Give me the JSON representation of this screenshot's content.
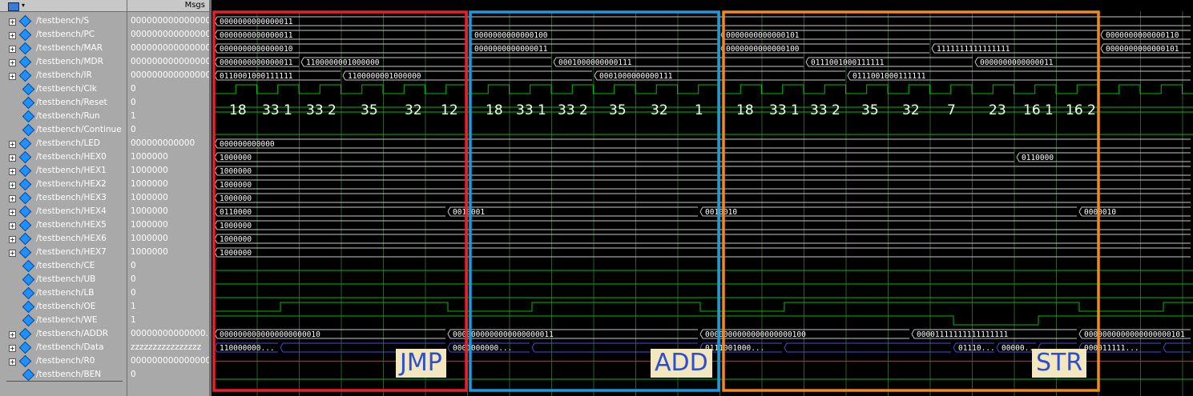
{
  "header": {
    "msgs_label": "Msgs"
  },
  "signals": [
    {
      "name": "/testbench/S",
      "value": "0000000000000000",
      "expandable": true
    },
    {
      "name": "/testbench/PC",
      "value": "0000000000000000",
      "expandable": true
    },
    {
      "name": "/testbench/MAR",
      "value": "0000000000000000",
      "expandable": true
    },
    {
      "name": "/testbench/MDR",
      "value": "0000000000000000",
      "expandable": true
    },
    {
      "name": "/testbench/IR",
      "value": "0000000000000000",
      "expandable": true
    },
    {
      "name": "/testbench/Clk",
      "value": "0",
      "expandable": false
    },
    {
      "name": "/testbench/Reset",
      "value": "0",
      "expandable": false
    },
    {
      "name": "/testbench/Run",
      "value": "1",
      "expandable": false
    },
    {
      "name": "/testbench/Continue",
      "value": "0",
      "expandable": false
    },
    {
      "name": "/testbench/LED",
      "value": "000000000000",
      "expandable": true
    },
    {
      "name": "/testbench/HEX0",
      "value": "1000000",
      "expandable": true
    },
    {
      "name": "/testbench/HEX1",
      "value": "1000000",
      "expandable": true
    },
    {
      "name": "/testbench/HEX2",
      "value": "1000000",
      "expandable": true
    },
    {
      "name": "/testbench/HEX3",
      "value": "1000000",
      "expandable": true
    },
    {
      "name": "/testbench/HEX4",
      "value": "1000000",
      "expandable": true
    },
    {
      "name": "/testbench/HEX5",
      "value": "1000000",
      "expandable": true
    },
    {
      "name": "/testbench/HEX6",
      "value": "1000000",
      "expandable": true
    },
    {
      "name": "/testbench/HEX7",
      "value": "1000000",
      "expandable": true
    },
    {
      "name": "/testbench/CE",
      "value": "0",
      "expandable": false
    },
    {
      "name": "/testbench/UB",
      "value": "0",
      "expandable": false
    },
    {
      "name": "/testbench/LB",
      "value": "0",
      "expandable": false
    },
    {
      "name": "/testbench/OE",
      "value": "1",
      "expandable": false
    },
    {
      "name": "/testbench/WE",
      "value": "1",
      "expandable": false
    },
    {
      "name": "/testbench/ADDR",
      "value": "00000000000000...",
      "expandable": true
    },
    {
      "name": "/testbench/Data",
      "value": "zzzzzzzzzzzzzzzz",
      "expandable": true
    },
    {
      "name": "/testbench/R0",
      "value": "0000000000000000",
      "expandable": true
    },
    {
      "name": "/testbench/BEN",
      "value": "0",
      "expandable": false
    }
  ],
  "wave_labels": {
    "S": [
      "0000000000000011"
    ],
    "PC": [
      "0000000000000011",
      "0000000000000100",
      "0000000000000101",
      "0000000000000110"
    ],
    "MAR": [
      "0000000000000010",
      "0000000000000011",
      "0000000000000100",
      "1111111111111111",
      "0000000000000101"
    ],
    "MDR": [
      "0000000000000011",
      "1100000001000000",
      "0001000000000111",
      "0111001000111111",
      "0000000000000011"
    ],
    "IR": [
      "0110001000111111",
      "1100000001000000",
      "0001000000000111",
      "0111001000111111"
    ],
    "LED": [
      "000000000000"
    ],
    "HEX0": [
      "1000000",
      "0110000"
    ],
    "HEX1": [
      "1000000"
    ],
    "HEX2": [
      "1000000"
    ],
    "HEX3": [
      "1000000"
    ],
    "HEX4": [
      "0110000",
      "0010001",
      "0010010",
      "0000010"
    ],
    "HEX5": [
      "1000000"
    ],
    "HEX6": [
      "1000000"
    ],
    "HEX7": [
      "1000000"
    ],
    "ADDR": [
      "0000000000000000000010",
      "0000000000000000000011",
      "0000000000000000000100",
      "00001111111111111111",
      "0000000000000000000101"
    ],
    "Data": [
      "110000000...",
      "0001000000...",
      "0111001000...",
      "01110...",
      "00000...",
      "000011111..."
    ]
  },
  "state_annotations": {
    "jmp": [
      "18",
      "33 1",
      "33 2",
      "35",
      "32",
      "12"
    ],
    "add": [
      "18",
      "33 1",
      "33 2",
      "35",
      "32",
      "1"
    ],
    "str": [
      "18",
      "33 1",
      "33 2",
      "35",
      "32",
      "7",
      "23",
      "16 1",
      "16 2"
    ]
  },
  "instructions": {
    "jmp": {
      "label": "JMP",
      "color": "#e8202a"
    },
    "add": {
      "label": "ADD",
      "color": "#1a9bdc"
    },
    "str": {
      "label": "STR",
      "color": "#f08a1c"
    }
  },
  "colors": {
    "clock": "#00c000",
    "bus": "#c8c8c8",
    "data_bus": "#3b4fd8",
    "r0": "#e01818",
    "grid": "#2e5a2e"
  }
}
